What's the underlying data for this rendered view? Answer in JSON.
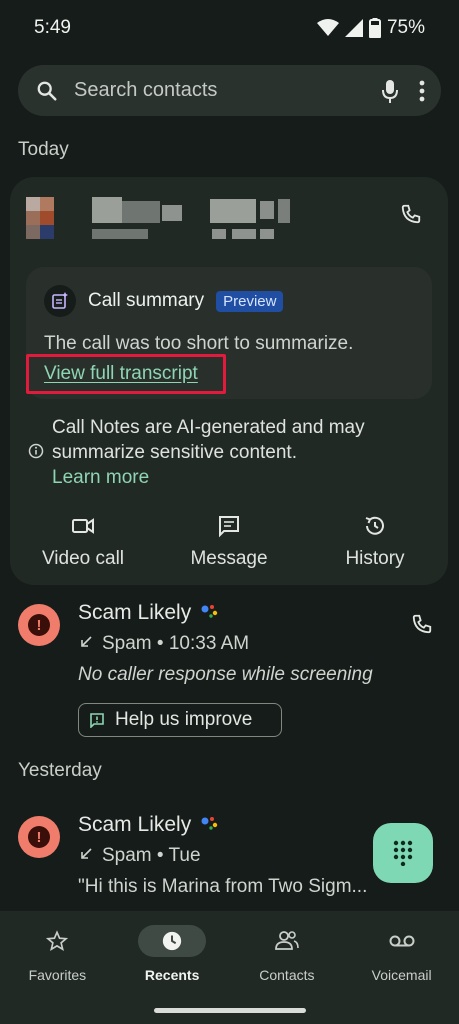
{
  "status": {
    "time": "5:49",
    "battery": "75%"
  },
  "search": {
    "placeholder": "Search contacts"
  },
  "sections": {
    "today": "Today",
    "yesterday": "Yesterday"
  },
  "summary": {
    "title": "Call summary",
    "badge": "Preview",
    "text": "The call was too short to summarize.",
    "link": "View full transcript"
  },
  "ai_note": {
    "text": "Call Notes are AI-generated and may summarize sensitive content.",
    "link": "Learn more"
  },
  "actions": [
    {
      "label": "Video call",
      "icon": "video-icon"
    },
    {
      "label": "Message",
      "icon": "message-icon"
    },
    {
      "label": "History",
      "icon": "history-icon"
    }
  ],
  "calls": [
    {
      "name": "Scam Likely",
      "detail": "Spam • 10:33 AM",
      "note": "No caller response while screening"
    },
    {
      "name": "Scam Likely",
      "detail": "Spam • Tue",
      "note": "\"Hi this is Marina from Two Sigm..."
    }
  ],
  "help_chip": "Help us improve",
  "nav": [
    {
      "label": "Favorites",
      "icon": "star-icon",
      "active": false
    },
    {
      "label": "Recents",
      "icon": "clock-icon",
      "active": true
    },
    {
      "label": "Contacts",
      "icon": "contacts-icon",
      "active": false
    },
    {
      "label": "Voicemail",
      "icon": "voicemail-icon",
      "active": false
    }
  ],
  "colors": {
    "background": "#161c19",
    "accent": "#8fd5b3",
    "highlight": "#e21b3c",
    "fab": "#7ed8b3",
    "spam": "#f07d6c"
  }
}
